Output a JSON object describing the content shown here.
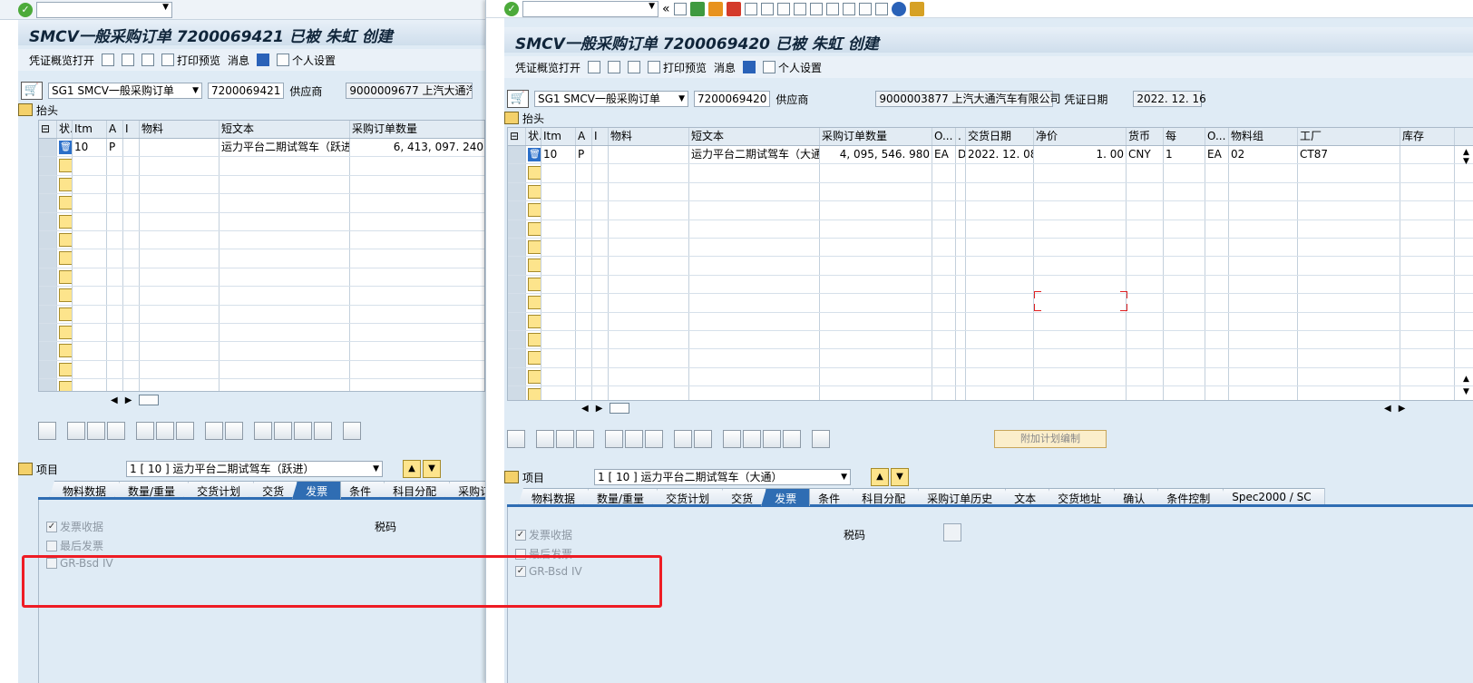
{
  "colors": {
    "accent": "#2f6db3",
    "annotation": "#ee1c24",
    "background": "#dfebf5"
  },
  "w1": {
    "title": "SMCV一般采购订单 7200069421 已被 朱虹 创建",
    "toolbar": {
      "overview": "凭证概览打开",
      "print_preview": "打印预览",
      "messages": "消息",
      "personal": "个人设置"
    },
    "header": {
      "doc_type": "SG1 SMCV一般采购订单",
      "po_number": "7200069421",
      "vendor_label": "供应商",
      "vendor_value": "9000009677 上汽大通汽"
    },
    "section_header": "抬头",
    "columns": [
      "状.",
      "Itm",
      "A",
      "I",
      "物料",
      "短文本",
      "采购订单数量"
    ],
    "row": {
      "itm": "10",
      "a": "P",
      "short_text": "运力平台二期试驾车（跃进）",
      "qty": "6, 413, 097. 240"
    },
    "item_label": "项目",
    "item_select": "1 [ 10 ] 运力平台二期试驾车（跃进）",
    "tabs": [
      "物料数据",
      "数量/重量",
      "交货计划",
      "交货",
      "发票",
      "条件",
      "科目分配",
      "采购订"
    ],
    "active_tab": "发票",
    "invoice": {
      "inv_receipt": "发票收据",
      "final_invoice": "最后发票",
      "gr_bsd_iv": "GR-Bsd IV",
      "tax_code": "税码"
    }
  },
  "w2": {
    "title": "SMCV一般采购订单 7200069420 已被 朱虹 创建",
    "toolbar": {
      "overview": "凭证概览打开",
      "print_preview": "打印预览",
      "messages": "消息",
      "personal": "个人设置"
    },
    "header": {
      "doc_type": "SG1 SMCV一般采购订单",
      "po_number": "7200069420",
      "vendor_label": "供应商",
      "vendor_value": "9000003877 上汽大通汽车有限公司",
      "doc_date_label": "凭证日期",
      "doc_date": "2022. 12. 16"
    },
    "section_header": "抬头",
    "columns": [
      "状.",
      "Itm",
      "A",
      "I",
      "物料",
      "短文本",
      "采购订单数量",
      "O...",
      ".",
      "交货日期",
      "净价",
      "货币",
      "每",
      "O...",
      "物料组",
      "工厂",
      "库存"
    ],
    "row": {
      "itm": "10",
      "a": "P",
      "short_text": "运力平台二期试驾车（大通）",
      "qty": "4, 095, 546. 980",
      "unit": "EA",
      "d": "D",
      "date": "2022. 12. 08",
      "price": "1. 00",
      "currency": "CNY",
      "per": "1",
      "ounit": "EA",
      "matgroup": "02",
      "plant": "CT87"
    },
    "plan_button": "附加计划编制",
    "item_label": "项目",
    "item_select": "1 [ 10 ] 运力平台二期试驾车（大通）",
    "tabs": [
      "物料数据",
      "数量/重量",
      "交货计划",
      "交货",
      "发票",
      "条件",
      "科目分配",
      "采购订单历史",
      "文本",
      "交货地址",
      "确认",
      "条件控制",
      "Spec2000 / SC"
    ],
    "active_tab": "发票",
    "invoice": {
      "inv_receipt": "发票收据",
      "final_invoice": "最后发票",
      "gr_bsd_iv": "GR-Bsd IV",
      "tax_code": "税码"
    }
  }
}
